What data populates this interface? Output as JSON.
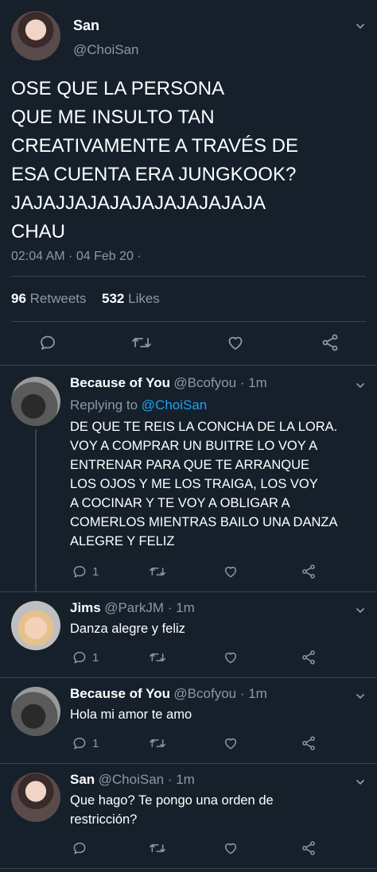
{
  "main_tweet": {
    "author_name": "San",
    "handle": "@ChoiSan",
    "text_lines": [
      "OSE QUE LA PERSONA",
      "QUE ME INSULTO TAN",
      "CREATIVAMENTE A TRAVÉS DE",
      "ESA CUENTA ERA JUNGKOOK?",
      "JAJAJJAJAJAJAJAJAJAJAJA",
      "CHAU"
    ],
    "timestamp": "02:04 AM · 04 Feb 20 ·",
    "retweets_count": "96",
    "retweets_label": "Retweets",
    "likes_count": "532",
    "likes_label": "Likes"
  },
  "replies": [
    {
      "author_name": "Because of You",
      "handle": "@Bcofyou · 1m",
      "replying_prefix": "Replying to",
      "replying_handle": "@ChoiSan",
      "text_lines": [
        "DE QUE TE REIS LA CONCHA DE LA LORA.",
        "VOY A COMPRAR UN BUITRE LO VOY A",
        "ENTRENAR PARA QUE TE ARRANQUE",
        "LOS OJOS Y ME LOS TRAIGA, LOS VOY",
        "A COCINAR Y TE VOY A OBLIGAR A",
        "COMERLOS MIENTRAS BAILO UNA DANZA",
        "ALEGRE Y FELIZ"
      ],
      "reply_count": "1"
    },
    {
      "author_name": "Jims",
      "handle": "@ParkJM · 1m",
      "text_lines": [
        "Danza alegre y feliz"
      ],
      "reply_count": "1"
    },
    {
      "author_name": "Because of You",
      "handle": "@Bcofyou · 1m",
      "text_lines": [
        "Hola mi amor te amo"
      ],
      "reply_count": "1"
    },
    {
      "author_name": "San",
      "handle": "@ChoiSan · 1m",
      "text_lines": [
        "Que hago? Te pongo una orden de",
        "restricción?"
      ],
      "reply_count": ""
    }
  ],
  "icons": [
    "chevron-down-icon",
    "reply-icon",
    "retweet-icon",
    "like-icon",
    "share-icon"
  ],
  "colors": {
    "background": "#15202b",
    "text": "#ffffff",
    "muted": "#8899a6",
    "link": "#1da1f2",
    "divider": "#38444d"
  }
}
